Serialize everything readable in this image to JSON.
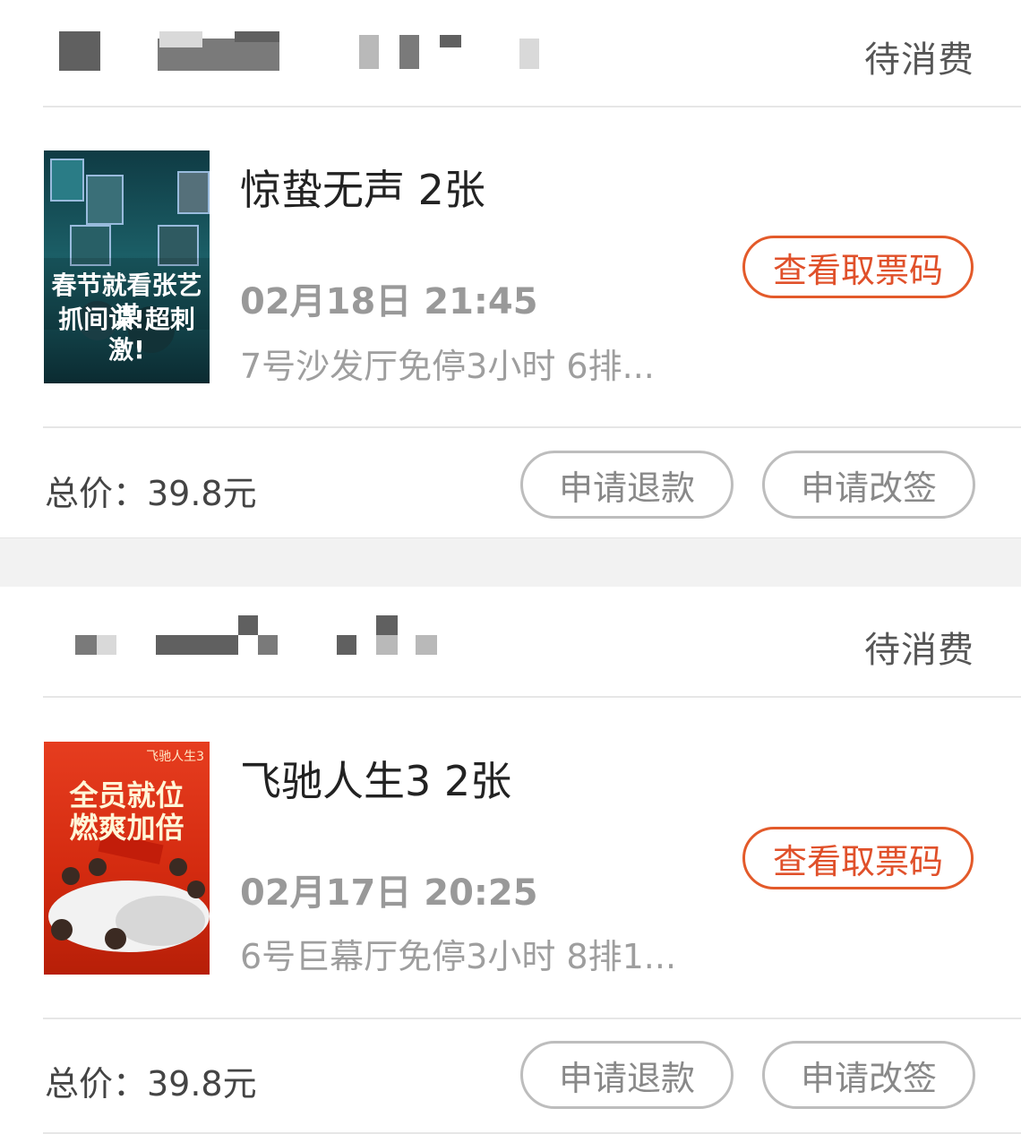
{
  "orders": [
    {
      "status": "待消费",
      "movie_title": "惊蛰无声 2张",
      "showtime": "02月18日 21:45",
      "hall": "7号沙发厅免停3小时 6排...",
      "view_code_label": "查看取票码",
      "total_label": "总价：39.8元",
      "refund_label": "申请退款",
      "change_label": "申请改签",
      "poster": {
        "lines": [
          "春节就看张艺谋",
          "抓间谍!超刺激!"
        ]
      }
    },
    {
      "status": "待消费",
      "movie_title": "飞驰人生3 2张",
      "showtime": "02月17日 20:25",
      "hall": "6号巨幕厅免停3小时 8排1...",
      "view_code_label": "查看取票码",
      "total_label": "总价：39.8元",
      "refund_label": "申请退款",
      "change_label": "申请改签",
      "poster": {
        "corner_title": "飞驰人生3",
        "lines": [
          "全员就位",
          "燃爽加倍"
        ]
      }
    }
  ],
  "colors": {
    "accent": "#e35a2a",
    "status_text": "#555555",
    "secondary_text": "#9e9e9e",
    "divider": "#e6e6e6"
  }
}
